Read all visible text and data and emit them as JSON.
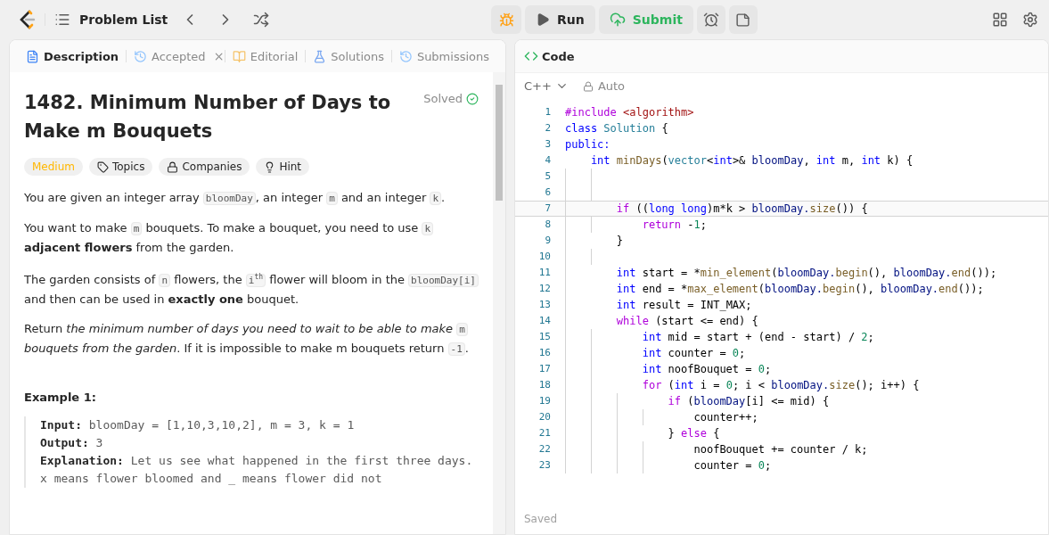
{
  "topbar": {
    "title": "Problem List",
    "run": "Run",
    "submit": "Submit"
  },
  "tabs": [
    {
      "label": "Description",
      "kind": "description",
      "selected": true
    },
    {
      "label": "Accepted",
      "kind": "result",
      "selected": false
    },
    {
      "label": "Editorial",
      "kind": "book",
      "selected": false
    },
    {
      "label": "Solutions",
      "kind": "flask",
      "selected": false
    },
    {
      "label": "Submissions",
      "kind": "history",
      "selected": false
    }
  ],
  "problem": {
    "title": "1482. Minimum Number of Days to Make m Bouquets",
    "status": "Solved",
    "tags": [
      {
        "label": "Medium",
        "kind": "difficulty"
      },
      {
        "label": "Topics",
        "kind": "tag"
      },
      {
        "label": "Companies",
        "kind": "lock"
      },
      {
        "label": "Hint",
        "kind": "bulb"
      }
    ],
    "paragraphs": [
      [
        {
          "text": "You are given an integer array ",
          "kind": "text"
        },
        {
          "text": "bloomDay",
          "kind": "code"
        },
        {
          "text": ", an integer ",
          "kind": "text"
        },
        {
          "text": "m",
          "kind": "code"
        },
        {
          "text": " and an integer ",
          "kind": "text"
        },
        {
          "text": "k",
          "kind": "code"
        },
        {
          "text": ".",
          "kind": "text"
        }
      ],
      [
        {
          "text": "You want to make ",
          "kind": "text"
        },
        {
          "text": "m",
          "kind": "code"
        },
        {
          "text": " bouquets. To make a bouquet, you need to use ",
          "kind": "text"
        },
        {
          "text": "k",
          "kind": "code"
        },
        {
          "text": " **adjacent flowers** from the garden.",
          "kind": "text"
        }
      ],
      [
        {
          "text": "The garden consists of ",
          "kind": "text"
        },
        {
          "text": "n",
          "kind": "code"
        },
        {
          "text": " flowers, the ",
          "kind": "text"
        },
        {
          "text": "i$^{th}$",
          "kind": "code"
        },
        {
          "text": " flower will bloom in the ",
          "kind": "text"
        },
        {
          "text": "bloomDay[i]",
          "kind": "code"
        },
        {
          "text": " and then can be used in **exactly one** bouquet.",
          "kind": "text"
        }
      ],
      [
        {
          "text": "Return *the minimum number of days you need to wait to be able to make* ",
          "kind": "text"
        },
        {
          "text": "m",
          "kind": "code"
        },
        {
          "text": " *bouquets from the garden*. If it is impossible to make m bouquets return ",
          "kind": "text"
        },
        {
          "text": "-1",
          "kind": "code"
        },
        {
          "text": ".",
          "kind": "text"
        }
      ]
    ],
    "example": {
      "title": "Example 1:",
      "lines": [
        "**Input:** bloomDay = [1,10,3,10,2], m = 3, k = 1",
        "**Output:** 3",
        "**Explanation:** Let us see what happened in the first three days. x means flower bloomed and _ means flower did not"
      ]
    }
  },
  "editor": {
    "title": "Code",
    "language": "C++",
    "mode": "Auto",
    "status": "Saved",
    "lines": [
      {
        "n": "1",
        "active": false,
        "tokens": [
          {
            "text": "#include ",
            "color": "#af00db"
          },
          {
            "text": "<algorithm>",
            "color": "#a31515"
          }
        ]
      },
      {
        "n": "2",
        "active": false,
        "tokens": [
          {
            "text": "class ",
            "color": "#0000ff"
          },
          {
            "text": "Solution",
            "color": "#267f99"
          },
          {
            "text": " {"
          }
        ]
      },
      {
        "n": "3",
        "active": false,
        "tokens": [
          {
            "text": "public:",
            "color": "#0000ff"
          }
        ]
      },
      {
        "n": "4",
        "active": false,
        "tokens": [
          {
            "text": "    int ",
            "color": "#0000ff"
          },
          {
            "text": "minDays",
            "color": "#795e26"
          },
          {
            "text": "("
          },
          {
            "text": "vector",
            "color": "#267f99"
          },
          {
            "text": "<"
          },
          {
            "text": "int",
            "color": "#0000ff"
          },
          {
            "text": ">& "
          },
          {
            "text": "bloomDay",
            "color": "#001080"
          },
          {
            "text": ", "
          },
          {
            "text": "int ",
            "color": "#0000ff"
          },
          {
            "text": "m, "
          },
          {
            "text": "int ",
            "color": "#0000ff"
          },
          {
            "text": "k) {"
          }
        ]
      },
      {
        "n": "5",
        "active": false
      },
      {
        "n": "6",
        "active": false
      },
      {
        "n": "7",
        "active": true,
        "tokens": [
          {
            "text": "        if",
            "color": "#af00db"
          },
          {
            "text": " (("
          },
          {
            "text": "long long",
            "color": "#0000ff"
          },
          {
            "text": ")m*k > "
          },
          {
            "text": "bloomDay.",
            "color": "#001080"
          },
          {
            "text": "size",
            "color": "#795e26"
          },
          {
            "text": "()) {"
          }
        ]
      },
      {
        "n": "8",
        "active": false,
        "tokens": [
          {
            "text": "            return",
            "color": "#af00db"
          },
          {
            "text": " -"
          },
          {
            "text": "1",
            "color": "#098658"
          },
          {
            "text": ";"
          }
        ]
      },
      {
        "n": "9",
        "active": false,
        "tokens": [
          {
            "text": "        }"
          }
        ]
      },
      {
        "n": "10",
        "active": false
      },
      {
        "n": "11",
        "active": false,
        "tokens": [
          {
            "text": "        int",
            "color": "#0000ff"
          },
          {
            "text": " start = *"
          },
          {
            "text": "min_element",
            "color": "#795e26"
          },
          {
            "text": "("
          },
          {
            "text": "bloomDay.",
            "color": "#001080"
          },
          {
            "text": "begin",
            "color": "#795e26"
          },
          {
            "text": "(), "
          },
          {
            "text": "bloomDay.",
            "color": "#001080"
          },
          {
            "text": "end",
            "color": "#795e26"
          },
          {
            "text": "());"
          }
        ]
      },
      {
        "n": "12",
        "active": false,
        "tokens": [
          {
            "text": "        int",
            "color": "#0000ff"
          },
          {
            "text": " end = *"
          },
          {
            "text": "max_element",
            "color": "#795e26"
          },
          {
            "text": "("
          },
          {
            "text": "bloomDay.",
            "color": "#001080"
          },
          {
            "text": "begin",
            "color": "#795e26"
          },
          {
            "text": "(), "
          },
          {
            "text": "bloomDay.",
            "color": "#001080"
          },
          {
            "text": "end",
            "color": "#795e26"
          },
          {
            "text": "());"
          }
        ]
      },
      {
        "n": "13",
        "active": false,
        "tokens": [
          {
            "text": "        int",
            "color": "#0000ff"
          },
          {
            "text": " result = INT_MAX;"
          }
        ]
      },
      {
        "n": "14",
        "active": false,
        "tokens": [
          {
            "text": "        while",
            "color": "#af00db"
          },
          {
            "text": " (start <= end) {"
          }
        ]
      },
      {
        "n": "15",
        "active": false,
        "tokens": [
          {
            "text": "            int",
            "color": "#0000ff"
          },
          {
            "text": " mid = start + (end - start) / "
          },
          {
            "text": "2",
            "color": "#098658"
          },
          {
            "text": ";"
          }
        ]
      },
      {
        "n": "16",
        "active": false,
        "tokens": [
          {
            "text": "            int",
            "color": "#0000ff"
          },
          {
            "text": " counter = "
          },
          {
            "text": "0",
            "color": "#098658"
          },
          {
            "text": ";"
          }
        ]
      },
      {
        "n": "17",
        "active": false,
        "tokens": [
          {
            "text": "            int",
            "color": "#0000ff"
          },
          {
            "text": " noofBouquet = "
          },
          {
            "text": "0",
            "color": "#098658"
          },
          {
            "text": ";"
          }
        ]
      },
      {
        "n": "18",
        "active": false,
        "tokens": [
          {
            "text": "            for",
            "color": "#af00db"
          },
          {
            "text": " ("
          },
          {
            "text": "int",
            "color": "#0000ff"
          },
          {
            "text": " i = "
          },
          {
            "text": "0",
            "color": "#098658"
          },
          {
            "text": "; i < "
          },
          {
            "text": "bloomDay.",
            "color": "#001080"
          },
          {
            "text": "size",
            "color": "#795e26"
          },
          {
            "text": "(); i++) {"
          }
        ]
      },
      {
        "n": "19",
        "active": false,
        "tokens": [
          {
            "text": "                if",
            "color": "#af00db"
          },
          {
            "text": " ("
          },
          {
            "text": "bloomDay",
            "color": "#001080"
          },
          {
            "text": "[i] <= mid) {"
          }
        ]
      },
      {
        "n": "20",
        "active": false,
        "tokens": [
          {
            "text": "                    counter++;"
          }
        ]
      },
      {
        "n": "21",
        "active": false,
        "tokens": [
          {
            "text": "                } "
          },
          {
            "text": "else",
            "color": "#af00db"
          },
          {
            "text": " {"
          }
        ]
      },
      {
        "n": "22",
        "active": false,
        "tokens": [
          {
            "text": "                    noofBouquet += counter / k;"
          }
        ]
      },
      {
        "n": "23",
        "active": false,
        "tokens": [
          {
            "text": "                    counter = "
          },
          {
            "text": "0",
            "color": "#098658"
          },
          {
            "text": ";"
          }
        ]
      }
    ]
  }
}
